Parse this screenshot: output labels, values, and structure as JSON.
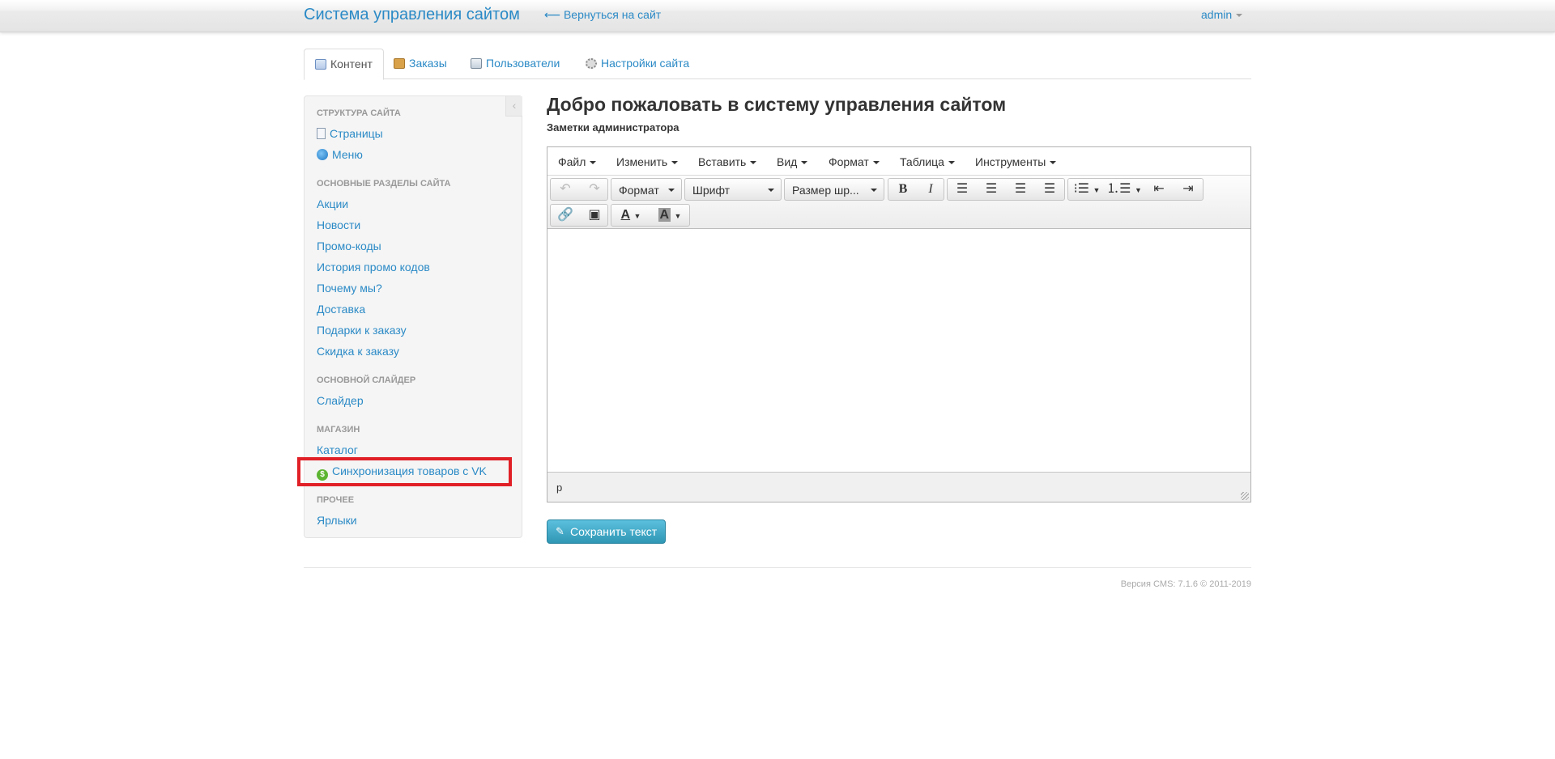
{
  "navbar": {
    "brand": "Система управления сайтом",
    "back_link": "⟵ Вернуться на сайт",
    "user": "admin"
  },
  "tabs": [
    {
      "label": "Контент",
      "icon": "content-icon",
      "active": true
    },
    {
      "label": "Заказы",
      "icon": "orders-icon",
      "active": false
    },
    {
      "label": "Пользователи",
      "icon": "users-icon",
      "active": false
    },
    {
      "label": "Настройки сайта",
      "icon": "settings-icon",
      "active": false
    }
  ],
  "sidebar": {
    "sections": [
      {
        "header": "Структура сайта",
        "items": [
          {
            "label": "Страницы",
            "icon": "pages-icon"
          },
          {
            "label": "Меню",
            "icon": "globe-icon"
          }
        ]
      },
      {
        "header": "Основные разделы сайта",
        "items": [
          {
            "label": "Акции"
          },
          {
            "label": "Новости"
          },
          {
            "label": "Промо-коды"
          },
          {
            "label": "История промо кодов"
          },
          {
            "label": "Почему мы?"
          },
          {
            "label": "Доставка"
          },
          {
            "label": "Подарки к заказу"
          },
          {
            "label": "Скидка к заказу"
          }
        ]
      },
      {
        "header": "Основной слайдер",
        "items": [
          {
            "label": "Слайдер"
          }
        ]
      },
      {
        "header": "Магазин",
        "items": [
          {
            "label": "Каталог"
          },
          {
            "label": "Синхронизация товаров с VK",
            "icon": "dollar-circle-icon",
            "highlighted": true
          }
        ]
      },
      {
        "header": "Прочее",
        "items": [
          {
            "label": "Ярлыки"
          }
        ]
      }
    ]
  },
  "main": {
    "title": "Добро пожаловать в систему управления сайтом",
    "subtitle": "Заметки администратора"
  },
  "editor": {
    "menu": [
      "Файл",
      "Изменить",
      "Вставить",
      "Вид",
      "Формат",
      "Таблица",
      "Инструменты"
    ],
    "format_select": "Формат",
    "font_select": "Шрифт",
    "size_select": "Размер шр...",
    "status_path": "p"
  },
  "save_button": "Сохранить текст",
  "footer": "Версия CMS: 7.1.6 © 2011-2019",
  "colors": {
    "link": "#2b8ac6",
    "save_button": "#49afcd",
    "highlight_box": "#e02026"
  }
}
